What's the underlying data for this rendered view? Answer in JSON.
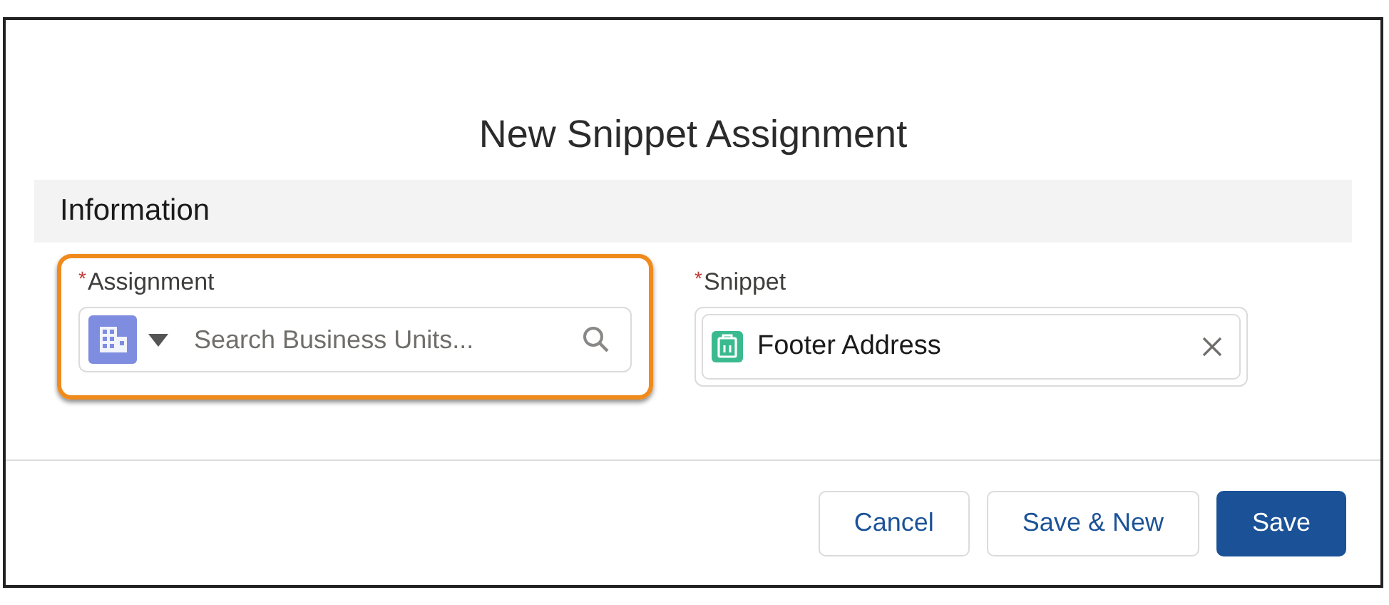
{
  "dialog": {
    "title": "New Snippet Assignment"
  },
  "section": {
    "title": "Information"
  },
  "fields": [
    {
      "label": "Assignment",
      "required_mark": "*",
      "kind": "lookup",
      "placeholder": "Search Business Units...",
      "highlighted": true
    },
    {
      "label": "Snippet",
      "required_mark": "*",
      "kind": "pill",
      "value": "Footer Address",
      "highlighted": false
    }
  ],
  "buttons": [
    {
      "label": "Cancel",
      "kind": "neutral"
    },
    {
      "label": "Save & New",
      "kind": "neutral"
    },
    {
      "label": "Save",
      "kind": "brand"
    }
  ]
}
